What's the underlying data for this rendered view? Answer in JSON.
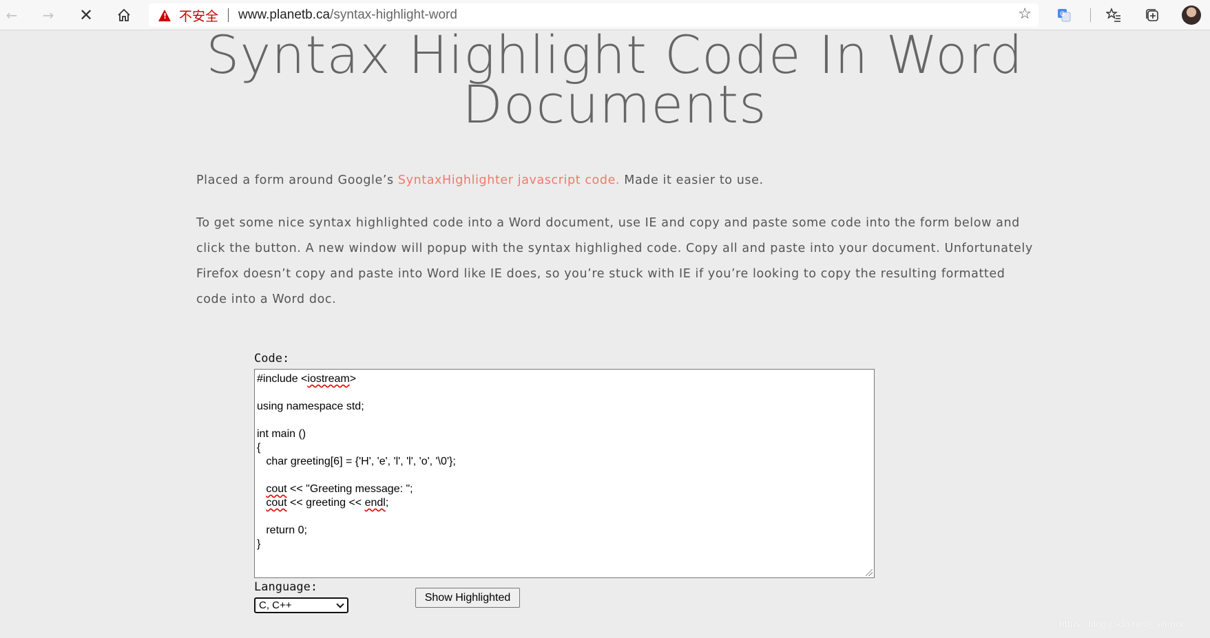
{
  "browser": {
    "security_label": "不安全",
    "url_host": "www.planetb.ca",
    "url_path": "/syntax-highlight-word",
    "icons": [
      "back-icon",
      "forward-icon",
      "stop-icon",
      "home-icon",
      "warning-icon",
      "star-icon",
      "translate-icon",
      "favorites-icon",
      "collections-icon",
      "avatar"
    ]
  },
  "page": {
    "title_line1": "Syntax Highlight Code In Word",
    "title_line2": "Documents",
    "intro_before": "Placed a form around Google’s ",
    "intro_link": "SyntaxHighlighter javascript code.",
    "intro_after": " Made it easier to use.",
    "instructions": "To get some nice syntax highlighted code into a Word document, use IE and copy and paste some code into the form below and click the button. A new window will popup with the syntax highlighed code. Copy all and paste into your document. Unfortunately Firefox doesn’t copy and paste into Word like IE does, so you’re stuck with IE if you’re looking to copy the resulting formatted code into a Word doc."
  },
  "form": {
    "code_label": "Code:",
    "code_lines": [
      "#include <iostream>",
      "",
      "using namespace std;",
      "",
      "int main ()",
      "{",
      "   char greeting[6] = {'H', 'e', 'l', 'l', 'o', '\\0'};",
      "",
      "   cout << \"Greeting message: \";",
      "   cout << greeting << endl;",
      "",
      "   return 0;",
      "}"
    ],
    "language_label": "Language:",
    "language_selected": "C, C++",
    "submit_label": "Show Highlighted"
  },
  "watermark": "https://blog.csdn.net/i_silence",
  "colors": {
    "background": "#ececec",
    "link": "#f1786a",
    "insecure": "#c80000"
  }
}
